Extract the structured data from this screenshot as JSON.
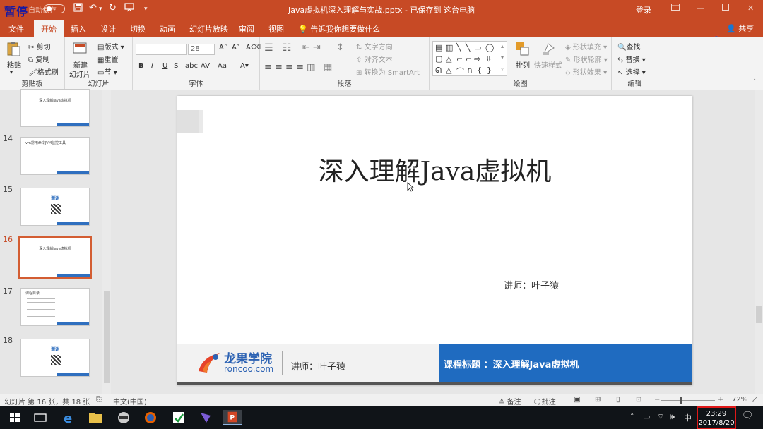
{
  "titlebar": {
    "pause_label": "暂停",
    "autosave_label": "自动保存",
    "doc_title": "Java虚拟机深入理解与实战.pptx - 已保存到 这台电脑",
    "login_label": "登录"
  },
  "tabs": [
    {
      "label": "文件"
    },
    {
      "label": "开始"
    },
    {
      "label": "插入"
    },
    {
      "label": "设计"
    },
    {
      "label": "切换"
    },
    {
      "label": "动画"
    },
    {
      "label": "幻灯片放映"
    },
    {
      "label": "审阅"
    },
    {
      "label": "视图"
    }
  ],
  "tell_me": "告诉我你想要做什么",
  "share_label": "共享",
  "ribbon": {
    "clipboard": {
      "paste": "粘贴",
      "cut": "剪切",
      "copy": "复制",
      "format_painter": "格式刷",
      "label": "剪贴板"
    },
    "slides": {
      "new_slide_1": "新建",
      "new_slide_2": "幻灯片",
      "layout": "版式",
      "reset": "重置",
      "section": "节",
      "label": "幻灯片"
    },
    "font": {
      "font_size": "28",
      "bold": "B",
      "italic": "I",
      "underline": "U",
      "strike": "S",
      "shadow": "abc",
      "spacing": "AV",
      "case": "Aa",
      "label": "字体"
    },
    "paragraph": {
      "text_direction": "文字方向",
      "align_text": "对齐文本",
      "smartart": "转换为 SmartArt",
      "label": "段落"
    },
    "drawing": {
      "arrange": "排列",
      "quick_styles": "快速样式",
      "shape_fill": "形状填充",
      "shape_outline": "形状轮廓",
      "shape_effects": "形状效果",
      "label": "绘图"
    },
    "editing": {
      "find": "查找",
      "replace": "替换",
      "select": "选择",
      "label": "编辑"
    }
  },
  "thumbnails": [
    {
      "num": "",
      "title": "深入理解Java虚拟机",
      "kind": "title"
    },
    {
      "num": "14",
      "title": "vm常用命令JVM监控工具",
      "kind": "text"
    },
    {
      "num": "15",
      "title": "谢谢",
      "kind": "thanks"
    },
    {
      "num": "16",
      "title": "深入理解Java虚拟机",
      "kind": "title"
    },
    {
      "num": "17",
      "title": "课程目录",
      "kind": "list"
    },
    {
      "num": "18",
      "title": "谢谢",
      "kind": "thanks"
    }
  ],
  "slide": {
    "title": "深入理解Java虚拟机",
    "lecturer": "讲师：叶子猿",
    "footer_brand": "龙果学院",
    "footer_domain": "roncoo.com",
    "footer_lecturer": "讲师：叶子猿",
    "footer_course": "课程标题 ：深入理解Java虚拟机"
  },
  "status": {
    "slide_count": "幻灯片 第 16 张，共 18 张",
    "language": "中文(中国)",
    "notes": "备注",
    "comments": "批注",
    "zoom": "72%"
  },
  "taskbar": {
    "time": "23:29",
    "date": "2017/8/20",
    "ime": "中"
  },
  "colors": {
    "accent": "#c74a25",
    "slide_blue": "#1f6bc0"
  }
}
